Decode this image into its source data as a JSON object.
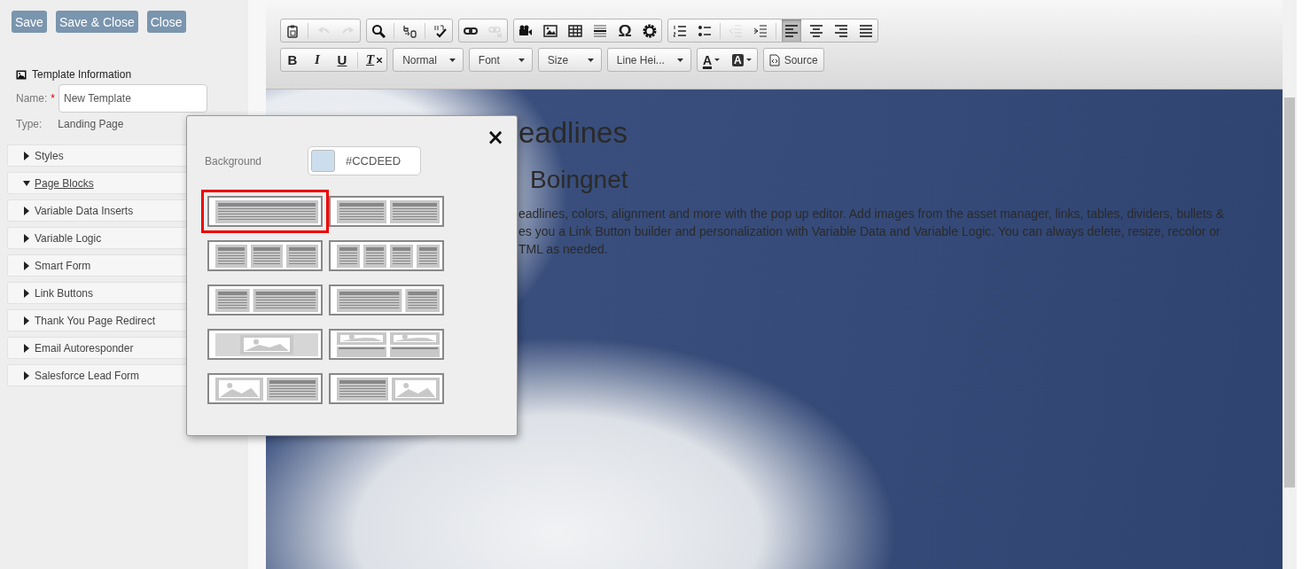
{
  "actions": [
    "Save",
    "Save & Close",
    "Close"
  ],
  "template_info": {
    "title": "Template Information",
    "name_label": "Name:",
    "required_mark": "*",
    "name_value": "New Template",
    "type_label": "Type:",
    "type_value": "Landing Page"
  },
  "sections": [
    {
      "label": "Styles",
      "expanded": false
    },
    {
      "label": "Page Blocks",
      "expanded": true
    },
    {
      "label": "Variable Data Inserts",
      "expanded": false
    },
    {
      "label": "Variable Logic",
      "expanded": false
    },
    {
      "label": "Smart Form",
      "expanded": false
    },
    {
      "label": "Link Buttons",
      "expanded": false
    },
    {
      "label": "Thank You Page Redirect",
      "expanded": false
    },
    {
      "label": "Email Autoresponder",
      "expanded": false
    },
    {
      "label": "Salesforce Lead Form",
      "expanded": false
    }
  ],
  "toolbar": {
    "rows": [
      {
        "groups": [
          {
            "items": [
              {
                "kind": "paste-word",
                "disabled": false
              },
              {
                "kind": "undo",
                "disabled": true
              },
              {
                "kind": "redo",
                "disabled": true
              }
            ]
          },
          {
            "items": [
              {
                "kind": "find",
                "disabled": false
              },
              {
                "kind": "replace",
                "disabled": false
              },
              {
                "kind": "spellcheck",
                "disabled": false
              }
            ]
          },
          {
            "items": [
              {
                "kind": "link",
                "disabled": false
              },
              {
                "kind": "unlink",
                "disabled": true
              }
            ]
          },
          {
            "items": [
              {
                "kind": "video",
                "disabled": false
              },
              {
                "kind": "image",
                "disabled": false
              },
              {
                "kind": "table",
                "disabled": false
              },
              {
                "kind": "rule",
                "disabled": false
              },
              {
                "kind": "special-character",
                "label": "Ω",
                "disabled": false
              },
              {
                "kind": "gear",
                "disabled": false
              }
            ]
          },
          {
            "items": [
              {
                "kind": "numbered-list",
                "disabled": false
              },
              {
                "kind": "bulleted-list",
                "disabled": false
              },
              {
                "kind": "outdent",
                "disabled": true
              },
              {
                "kind": "indent",
                "disabled": false
              },
              {
                "kind": "align-left",
                "disabled": false,
                "selected": true
              },
              {
                "kind": "align-center",
                "disabled": false,
                "selected": false
              },
              {
                "kind": "align-right",
                "disabled": false,
                "selected": false
              },
              {
                "kind": "justify",
                "disabled": false,
                "selected": false
              }
            ]
          }
        ]
      },
      {
        "groups": [
          {
            "items": [
              {
                "kind": "bold",
                "label": "B"
              },
              {
                "kind": "italic",
                "label": "I"
              },
              {
                "kind": "underline",
                "label": "U"
              },
              {
                "kind": "remove-format",
                "label": "T"
              }
            ]
          },
          {
            "items": [
              {
                "kind": "dropdown",
                "label": "Normal"
              }
            ]
          },
          {
            "items": [
              {
                "kind": "dropdown",
                "label": "Font"
              }
            ]
          },
          {
            "items": [
              {
                "kind": "dropdown",
                "label": "Size"
              }
            ]
          },
          {
            "items": [
              {
                "kind": "dropdown",
                "label": "Line Hei..."
              }
            ]
          },
          {
            "items": [
              {
                "kind": "text-color",
                "label": "A"
              },
              {
                "kind": "background-color",
                "label": "A"
              }
            ]
          },
          {
            "items": [
              {
                "kind": "source",
                "label": "Source"
              }
            ]
          }
        ]
      }
    ]
  },
  "content": {
    "headline": "eadlines",
    "subheadline": "Boingnet",
    "paragraph_lines": [
      "eadlines, colors, alignment and more with the pop up editor. Add images from the asset manager, links, tables, dividers, bullets &",
      "es you a Link Button builder and personalization with Variable Data and Variable Logic. You can always delete, resize, recolor or",
      "TML as needed."
    ]
  },
  "popup": {
    "close": "×",
    "background_label": "Background",
    "background_value": "#CCDEED",
    "layouts": [
      {
        "kind": "one-column",
        "selected": true
      },
      {
        "kind": "two-columns",
        "selected": false
      },
      {
        "kind": "three-columns",
        "selected": false
      },
      {
        "kind": "four-columns",
        "selected": false
      },
      {
        "kind": "narrow-wide",
        "selected": false
      },
      {
        "kind": "wide-narrow",
        "selected": false
      },
      {
        "kind": "image-banner",
        "selected": false
      },
      {
        "kind": "two-images-over-text",
        "selected": false
      },
      {
        "kind": "image-text",
        "selected": false
      },
      {
        "kind": "text-image",
        "selected": false
      }
    ]
  }
}
